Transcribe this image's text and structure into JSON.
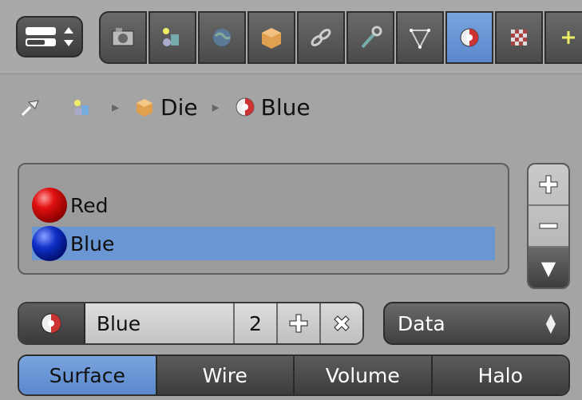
{
  "tabs": [
    {
      "icon": "render-camera-icon",
      "active": false
    },
    {
      "icon": "scene-icon",
      "active": false
    },
    {
      "icon": "world-icon",
      "active": false
    },
    {
      "icon": "object-cube-icon",
      "active": false
    },
    {
      "icon": "constraints-link-icon",
      "active": false
    },
    {
      "icon": "modifiers-wrench-icon",
      "active": false
    },
    {
      "icon": "mesh-data-icon",
      "active": false
    },
    {
      "icon": "material-icon",
      "active": true
    },
    {
      "icon": "texture-icon",
      "active": false
    },
    {
      "icon": "particles-icon",
      "active": false
    }
  ],
  "breadcrumb": {
    "object_label": "Die",
    "material_label": "Blue"
  },
  "material_slots": [
    {
      "name": "Red",
      "color": "#d01010",
      "selected": false
    },
    {
      "name": "Blue",
      "color": "#1030c8",
      "selected": true
    }
  ],
  "slot_buttons": {
    "add": "+",
    "remove": "−",
    "menu": "▼"
  },
  "material": {
    "name": "Blue",
    "users": "2",
    "add_glyph": "+",
    "unlink_glyph": "✕"
  },
  "link_dropdown": {
    "value": "Data"
  },
  "preview_tabs": [
    "Surface",
    "Wire",
    "Volume",
    "Halo"
  ],
  "active_preview_tab": "Surface",
  "colors": {
    "accent": "#6a97d4",
    "panel": "#a4a4a4"
  }
}
